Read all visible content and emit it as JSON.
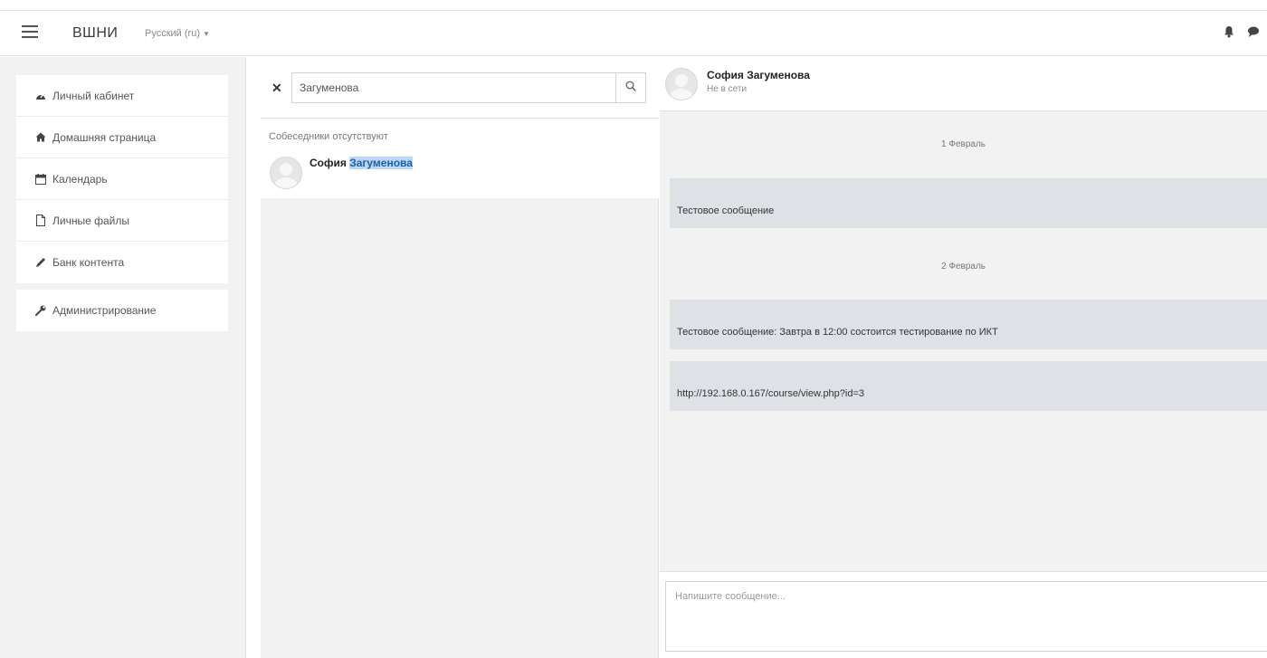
{
  "navbar": {
    "brand": "ВШНИ",
    "language": "Русский (ru)",
    "icons": [
      "bell-icon",
      "comment-icon"
    ]
  },
  "drawer": {
    "items": [
      {
        "label": "Личный кабинет",
        "icon": "dashboard-icon"
      },
      {
        "label": "Домашняя страница",
        "icon": "home-icon"
      },
      {
        "label": "Календарь",
        "icon": "calendar-icon"
      },
      {
        "label": "Личные файлы",
        "icon": "file-icon"
      },
      {
        "label": "Банк контента",
        "icon": "pencil-icon"
      }
    ],
    "admin": {
      "label": "Администрирование",
      "icon": "wrench-icon"
    }
  },
  "contacts": {
    "search": {
      "value": "Загуменова",
      "placeholder": ""
    },
    "no_contacts": "Собеседники отсутствуют",
    "result": {
      "name_first": "София ",
      "name_highlight": "Загуменова"
    }
  },
  "conversation": {
    "name": "София Загуменова",
    "status": "Не в сети",
    "days": [
      {
        "date": "1 Февраль",
        "messages": [
          "Тестовое сообщение"
        ]
      },
      {
        "date": "2 Февраль",
        "messages": [
          "Тестовое сообщение: Завтра в 12:00 состоится тестирование по ИКТ",
          "http://192.168.0.167/course/view.php?id=3"
        ]
      }
    ],
    "composer_placeholder": "Напишите сообщение..."
  }
}
